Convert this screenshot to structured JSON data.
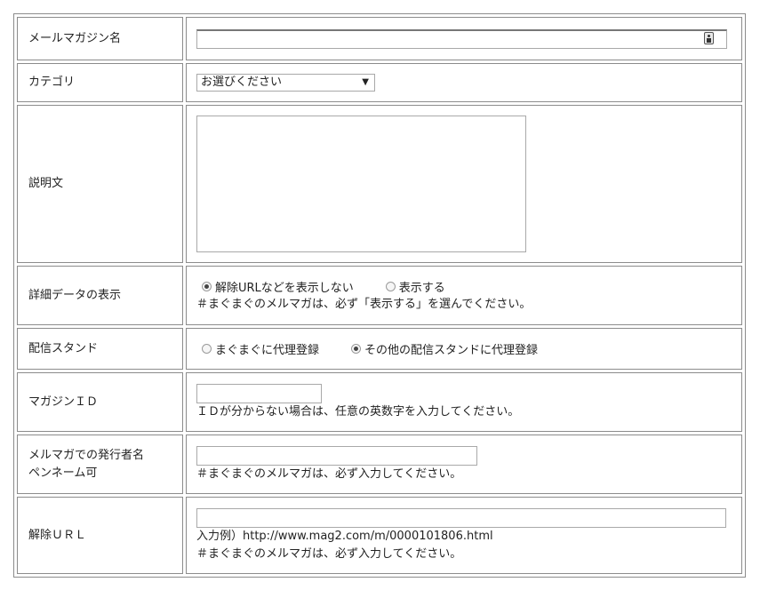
{
  "rows": {
    "magazine_name": {
      "label": "メールマガジン名",
      "value": ""
    },
    "category": {
      "label": "カテゴリ",
      "selected": "お選びください",
      "arrow": "▼"
    },
    "description": {
      "label": "説明文",
      "value": ""
    },
    "detail_display": {
      "label": "詳細データの表示",
      "options": [
        "解除URLなどを表示しない",
        "表示する"
      ],
      "selected_index": 0,
      "note": "＃まぐまぐのメルマガは、必ず「表示する」を選んでください。"
    },
    "distribution_stand": {
      "label": "配信スタンド",
      "options": [
        "まぐまぐに代理登録",
        "その他の配信スタンドに代理登録"
      ],
      "selected_index": 1
    },
    "magazine_id": {
      "label": "マガジンＩＤ",
      "value": "",
      "note": "ＩＤが分からない場合は、任意の英数字を入力してください。"
    },
    "publisher_name": {
      "label_line1": "メルマガでの発行者名",
      "label_line2": "ペンネーム可",
      "value": "",
      "note": "＃まぐまぐのメルマガは、必ず入力してください。"
    },
    "unsubscribe_url": {
      "label": "解除ＵＲＬ",
      "value": "",
      "example": "入力例）http://www.mag2.com/m/0000101806.html",
      "note": "＃まぐまぐのメルマガは、必ず入力してください。"
    }
  },
  "icons": {
    "contact_autofill": "contact-card-icon",
    "select_arrow": "chevron-down-icon"
  }
}
